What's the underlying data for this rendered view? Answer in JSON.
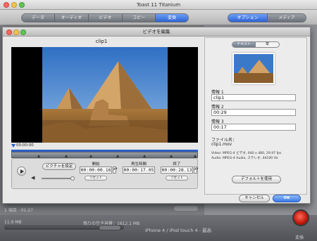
{
  "window": {
    "title": "Toast 11 Titanium"
  },
  "toolbar": {
    "tabs": [
      "データ",
      "オーディオ",
      "ビデオ",
      "コピー",
      "変換"
    ],
    "right_tabs": [
      "オプション",
      "メディア"
    ]
  },
  "status": {
    "items_count": "1 項目 - 01:27"
  },
  "bottom": {
    "size": "11.9 MB",
    "free_space": "残りの空き容量：1612.1 MB",
    "device": "iPhone 4 / iPod touch 4 - 最高",
    "convert": "変換"
  },
  "dialog": {
    "title": "ビデオを編集",
    "clip_title": "clip1",
    "timecode": "00:00:00",
    "poster_label": "ピクチャを設定",
    "start": {
      "label": "開始",
      "value": "00:00:00.16",
      "reset": "リセット"
    },
    "duration": {
      "label": "再生時間",
      "value": "00:00:17.05"
    },
    "end": {
      "label": "終了",
      "value": "00:00:28.13",
      "reset": "リセット"
    },
    "tabs": [
      "テキスト",
      "章"
    ],
    "info1": {
      "label": "情報 1",
      "value": "clip1"
    },
    "info2": {
      "label": "情報 2",
      "value": "00:29"
    },
    "info3": {
      "label": "情報 3",
      "value": "00:17"
    },
    "file": {
      "label": "ファイル名：",
      "name": "clip1.mov"
    },
    "video_meta": "Video: MPEG-4 ビデオ, 640 x 480, 29.97 fps",
    "audio_meta": "Audio: MPEG-4 Audio, ステレオ, 44100 Hz",
    "default_button": "デフォルトを使用",
    "cancel": "キャンセル",
    "ok": "OK"
  },
  "colors": {
    "accent": "#3b78e7",
    "record": "#d81e10"
  },
  "icons": [
    "close-icon",
    "minimize-icon",
    "zoom-icon",
    "play-icon",
    "volume-icon",
    "record-icon"
  ]
}
